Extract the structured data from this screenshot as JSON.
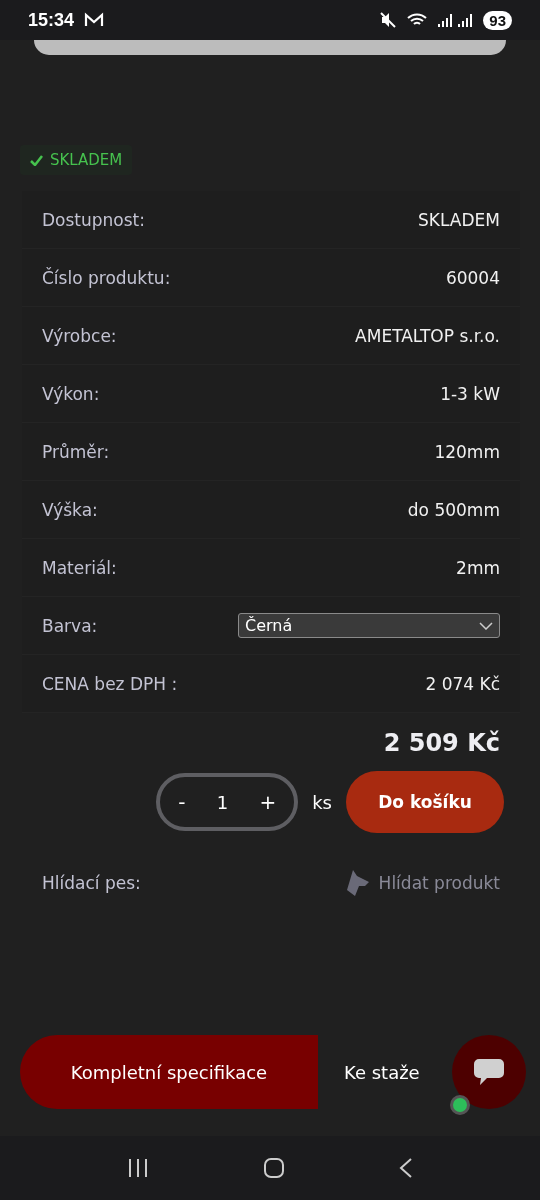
{
  "status_bar": {
    "time": "15:34",
    "battery": "93"
  },
  "stock_badge": {
    "label": "SKLADEM"
  },
  "specs": [
    {
      "kind": "text",
      "label": "Dostupnost:",
      "value": "SKLADEM"
    },
    {
      "kind": "text",
      "label": "Číslo produktu:",
      "value": "60004"
    },
    {
      "kind": "text",
      "label": "Výrobce:",
      "value": "AMETALTOP s.r.o."
    },
    {
      "kind": "text",
      "label": "Výkon:",
      "value": "1-3 kW"
    },
    {
      "kind": "text",
      "label": "Průměr:",
      "value": "120mm"
    },
    {
      "kind": "text",
      "label": "Výška:",
      "value": "do 500mm"
    },
    {
      "kind": "text",
      "label": "Materiál:",
      "value": "2mm"
    },
    {
      "kind": "select",
      "label": "Barva:",
      "value": "Černá"
    },
    {
      "kind": "text",
      "label": "CENA bez DPH :",
      "value": "2 074 Kč"
    }
  ],
  "price": "2 509 Kč",
  "quantity": {
    "minus": "-",
    "value": "1",
    "plus": "+",
    "unit": "ks"
  },
  "add_to_cart": "Do košíku",
  "watchdog": {
    "label": "Hlídací pes:",
    "action": "Hlídat produkt"
  },
  "tabs": [
    {
      "label": "Kompletní specifikace",
      "selected": true
    },
    {
      "label": "Ke staže",
      "selected": false
    }
  ],
  "chat": {
    "online": true,
    "color": "#2dbe5a"
  }
}
